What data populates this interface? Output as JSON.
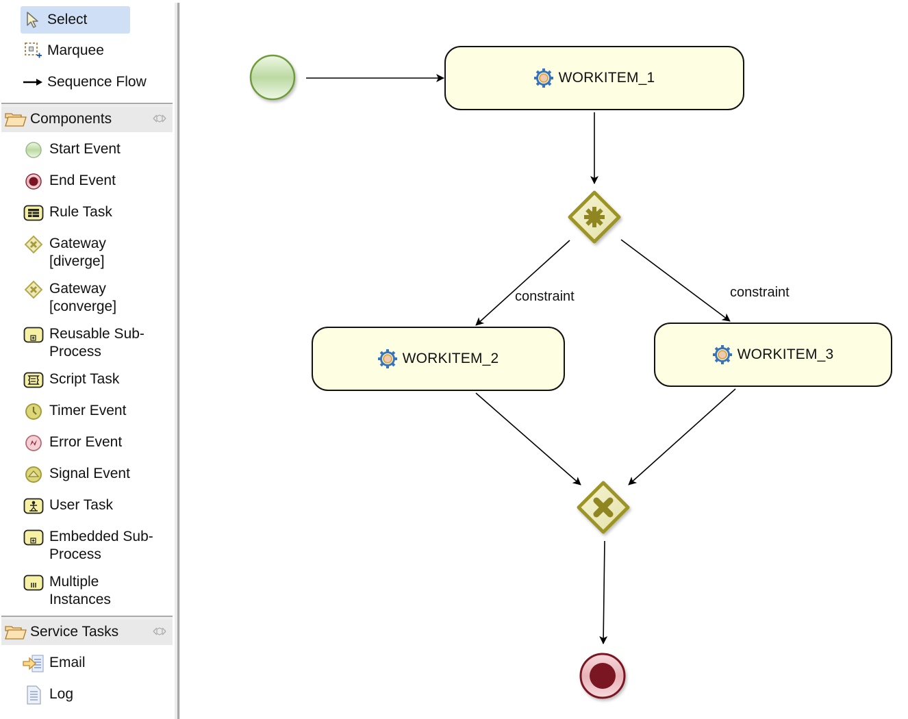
{
  "palette": {
    "tools": [
      {
        "label": "Select",
        "icon": "arrow-cursor-icon",
        "selected": true
      },
      {
        "label": "Marquee",
        "icon": "marquee-icon",
        "selected": false
      },
      {
        "label": "Sequence Flow",
        "icon": "sequence-flow-icon",
        "selected": false
      }
    ],
    "drawers": [
      {
        "label": "Components",
        "icon": "folder-open-icon",
        "items": [
          {
            "label": "Start Event",
            "icon": "start-event-icon"
          },
          {
            "label": "End Event",
            "icon": "end-event-icon"
          },
          {
            "label": "Rule Task",
            "icon": "rule-task-icon"
          },
          {
            "label": "Gateway\n[diverge]",
            "icon": "gateway-diverge-icon"
          },
          {
            "label": "Gateway\n[converge]",
            "icon": "gateway-converge-icon"
          },
          {
            "label": "Reusable Sub-\nProcess",
            "icon": "reusable-subprocess-icon"
          },
          {
            "label": "Script Task",
            "icon": "script-task-icon"
          },
          {
            "label": "Timer Event",
            "icon": "timer-event-icon"
          },
          {
            "label": "Error Event",
            "icon": "error-event-icon"
          },
          {
            "label": "Signal Event",
            "icon": "signal-event-icon"
          },
          {
            "label": "User Task",
            "icon": "user-task-icon"
          },
          {
            "label": "Embedded Sub-\nProcess",
            "icon": "embedded-subprocess-icon"
          },
          {
            "label": "Multiple\nInstances",
            "icon": "multiple-instances-icon"
          }
        ]
      },
      {
        "label": "Service Tasks",
        "icon": "folder-open-icon",
        "items": [
          {
            "label": "Email",
            "icon": "email-icon"
          },
          {
            "label": "Log",
            "icon": "log-icon"
          }
        ]
      }
    ]
  },
  "diagram": {
    "nodes": {
      "start": {
        "type": "start-event"
      },
      "workitem1": {
        "type": "task",
        "label": "WORKITEM_1"
      },
      "split": {
        "type": "gateway-diverge",
        "symbol": "asterisk"
      },
      "workitem2": {
        "type": "task",
        "label": "WORKITEM_2"
      },
      "workitem3": {
        "type": "task",
        "label": "WORKITEM_3"
      },
      "join": {
        "type": "gateway-converge",
        "symbol": "x"
      },
      "end": {
        "type": "end-event"
      }
    },
    "flows": [
      {
        "from": "start",
        "to": "workitem1",
        "label": ""
      },
      {
        "from": "workitem1",
        "to": "split",
        "label": ""
      },
      {
        "from": "split",
        "to": "workitem2",
        "label": "constraint"
      },
      {
        "from": "split",
        "to": "workitem3",
        "label": "constraint"
      },
      {
        "from": "workitem2",
        "to": "join",
        "label": ""
      },
      {
        "from": "workitem3",
        "to": "join",
        "label": ""
      },
      {
        "from": "join",
        "to": "end",
        "label": ""
      }
    ]
  },
  "colors": {
    "selection": "#cfe0f6",
    "task_fill": "#fefee2",
    "gateway": "#9d9428",
    "start_event": "#6f9a3a",
    "end_event": "#7a1424"
  }
}
